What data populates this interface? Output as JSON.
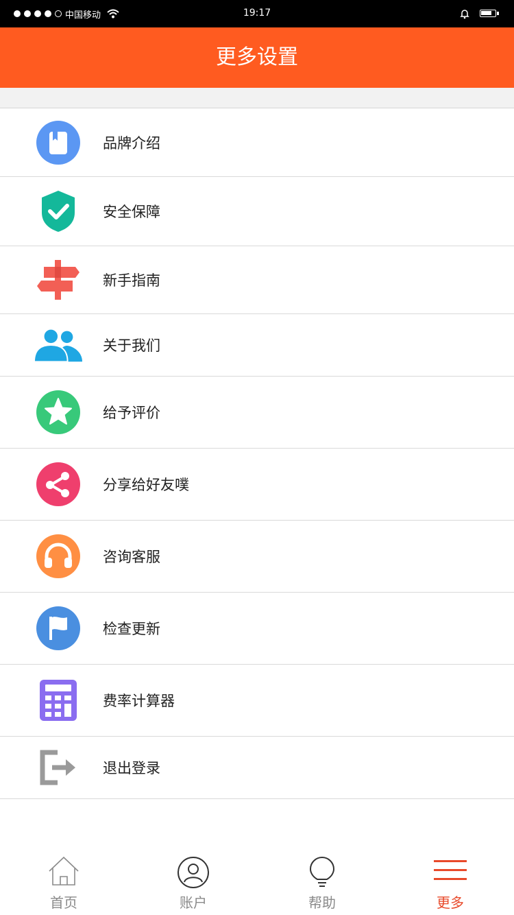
{
  "status_bar": {
    "carrier": "中国移动",
    "time": "19:17"
  },
  "header": {
    "title": "更多设置"
  },
  "menu": [
    {
      "label": "品牌介绍",
      "icon": "brand-book-icon",
      "color": "#5b97f3"
    },
    {
      "label": "安全保障",
      "icon": "shield-check-icon",
      "color": "#14b89a"
    },
    {
      "label": "新手指南",
      "icon": "signpost-icon",
      "color": "#f25f55"
    },
    {
      "label": "关于我们",
      "icon": "users-icon",
      "color": "#1fa7e3"
    },
    {
      "label": "给予评价",
      "icon": "star-icon",
      "color": "#38c97a"
    },
    {
      "label": "分享给好友噗",
      "icon": "share-icon",
      "color": "#ef3f6d"
    },
    {
      "label": "咨询客服",
      "icon": "headphones-icon",
      "color": "#ff8f43"
    },
    {
      "label": "检查更新",
      "icon": "flag-icon",
      "color": "#4a8fe0"
    },
    {
      "label": "费率计算器",
      "icon": "calculator-icon",
      "color": "#8a6df0"
    },
    {
      "label": "退出登录",
      "icon": "logout-icon",
      "color": "#9a9a9a"
    }
  ],
  "tabs": [
    {
      "label": "首页",
      "icon": "home-icon"
    },
    {
      "label": "账户",
      "icon": "account-icon"
    },
    {
      "label": "帮助",
      "icon": "lightbulb-icon"
    },
    {
      "label": "更多",
      "icon": "menu-icon",
      "active": true
    }
  ],
  "colors": {
    "accent": "#ff5b20",
    "active_tab": "#e8492a",
    "inactive_tab": "#8a8a8a"
  }
}
